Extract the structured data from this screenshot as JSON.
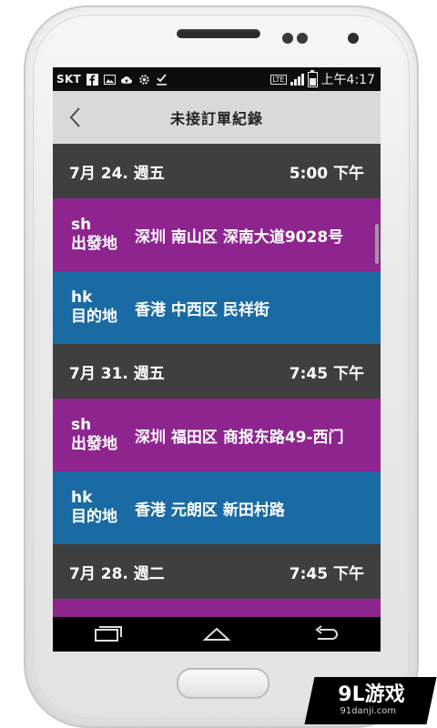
{
  "status_bar": {
    "carrier": "SKT",
    "icons": [
      "facebook-icon",
      "image-icon",
      "cloud-upload-icon",
      "settings-icon",
      "download-done-icon"
    ],
    "network": "LTE",
    "time": "上午4:17"
  },
  "header": {
    "title": "未接訂單紀錄",
    "back_icon": "chevron-left-icon"
  },
  "orders": [
    {
      "date": "7月 24. 週五",
      "time": "5:00 下午",
      "origin": {
        "code": "sh",
        "role": "出發地",
        "address": "深圳 南山区 深南大道9028号"
      },
      "destination": {
        "code": "hk",
        "role": "目的地",
        "address": "香港 中西区 民祥街"
      }
    },
    {
      "date": "7月 31. 週五",
      "time": "7:45 下午",
      "origin": {
        "code": "sh",
        "role": "出發地",
        "address": "深圳 福田区 商报东路49-西门"
      },
      "destination": {
        "code": "hk",
        "role": "目的地",
        "address": "香港 元朗区 新田村路"
      }
    },
    {
      "date": "7月 28. 週二",
      "time": "7:45 下午"
    }
  ],
  "nav": {
    "icons": [
      "recent-apps-icon",
      "home-icon",
      "back-icon"
    ]
  },
  "watermark": {
    "main": "9L游戏",
    "sub": "91danji.com"
  },
  "colors": {
    "origin": "#8e248e",
    "destination": "#1a6aa3",
    "date_row": "#3f3f3f",
    "header": "#d9d9d9"
  }
}
